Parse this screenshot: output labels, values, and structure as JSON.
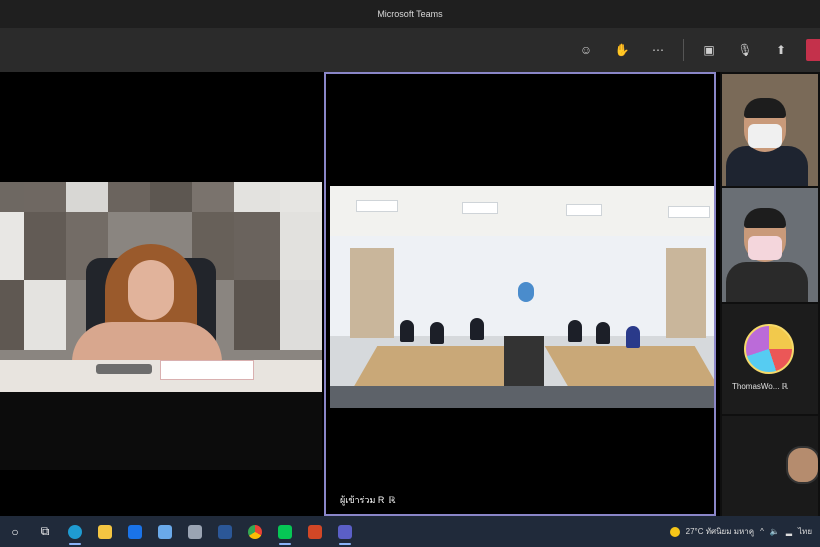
{
  "window": {
    "title": "Microsoft Teams"
  },
  "toolbar": {
    "icons": [
      "people-icon",
      "reactions-icon",
      "more-icon",
      "camera-icon",
      "mic-icon",
      "share-icon",
      "leave-icon"
    ]
  },
  "participants": {
    "center_name": "ผู้เข้าร่วม R",
    "center_suffix": "ℝ",
    "thumb3_name": "ThomasWo... ℝ"
  },
  "taskbar": {
    "weather": "27°C ทัศนิยม มหาคู",
    "tray_lang": "ไทย"
  },
  "colors": {
    "teams_purple": "#8a86c8",
    "leave_red": "#c4314b",
    "taskbar": "#202a3a"
  }
}
